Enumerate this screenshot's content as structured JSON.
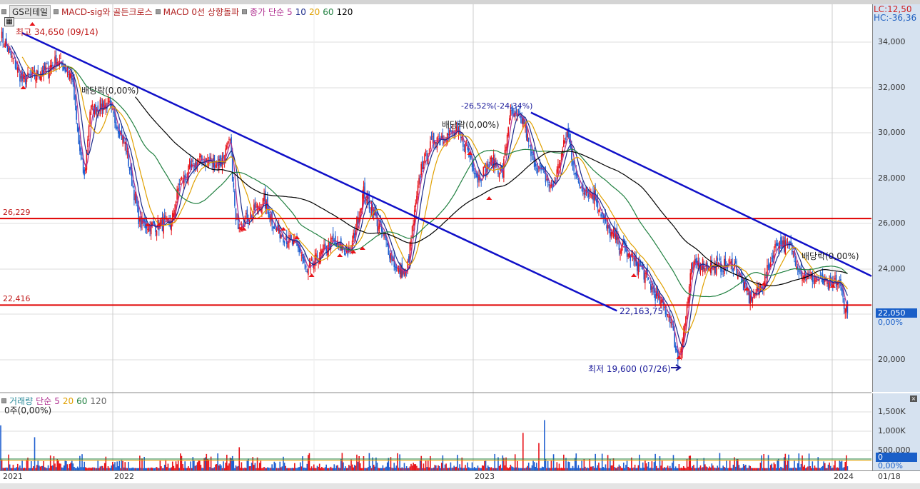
{
  "legend": {
    "symbol": "GS리테일",
    "items": [
      {
        "label": "MACD-sig와 골든크로스",
        "color": "#b22222"
      },
      {
        "label": "MACD 0선 상향돌파",
        "color": "#b22222"
      },
      {
        "label": "종가 단순",
        "color": "#b03090"
      }
    ],
    "ma": [
      {
        "label": "5",
        "color": "#b03090"
      },
      {
        "label": "10",
        "color": "#1a2a8a"
      },
      {
        "label": "20",
        "color": "#e0a000"
      },
      {
        "label": "60",
        "color": "#208040"
      },
      {
        "label": "120",
        "color": "#000000"
      }
    ]
  },
  "axis": {
    "lc": "LC:12,50",
    "hc": "HC:-36,36",
    "price_ticks": [
      "34,000",
      "32,000",
      "30,000",
      "28,000",
      "26,000",
      "24,000",
      "20,000"
    ],
    "current_price": "22,050",
    "current_pct": "0,00%",
    "volume_ticks": [
      "1,500K",
      "1,000K",
      "500,000"
    ],
    "volume_current": "0",
    "volume_pct": "0,00%",
    "date": "01/18"
  },
  "x_labels": [
    "2021",
    "2022",
    "2023",
    "2024"
  ],
  "annotations": {
    "high": "최고 34,650 (09/14)",
    "low": "최저 19,600 (07/26)",
    "div1": "배당락(0,00%)",
    "div2": "배당락(0,00%)",
    "div3": "배당락(0,00%)",
    "trend_pct": "-26,52%(-24,34%)",
    "trend_val": "22,163,75",
    "h1": "26,229",
    "h2": "22,416"
  },
  "volume_legend": {
    "title": "거래량",
    "simple": "단순",
    "ma": [
      {
        "label": "5",
        "color": "#b03090"
      },
      {
        "label": "20",
        "color": "#e0a000"
      },
      {
        "label": "60",
        "color": "#208040"
      },
      {
        "label": "120",
        "color": "#666666"
      }
    ],
    "value": "0주(0,00%)"
  },
  "colors": {
    "up": "#e8141a",
    "down": "#1f5fd0",
    "trend": "#1010c8",
    "hline": "#e00000"
  },
  "chart_data": {
    "type": "candlestick",
    "total_days": 750,
    "price_range": [
      19000,
      35000
    ],
    "hlines": [
      26229,
      22416
    ],
    "trendlines": [
      [
        [
          19,
          34400
        ],
        [
          545,
          22164
        ]
      ],
      [
        [
          469,
          30900
        ],
        [
          770,
          23700
        ]
      ]
    ],
    "waypoints": [
      [
        0,
        34300
      ],
      [
        13,
        33000
      ],
      [
        19,
        32300
      ],
      [
        38,
        32700
      ],
      [
        50,
        33200
      ],
      [
        63,
        32500
      ],
      [
        69,
        29500
      ],
      [
        74,
        28000
      ],
      [
        79,
        31000
      ],
      [
        95,
        31300
      ],
      [
        110,
        29500
      ],
      [
        123,
        26000
      ],
      [
        135,
        25900
      ],
      [
        151,
        26000
      ],
      [
        158,
        27800
      ],
      [
        176,
        28800
      ],
      [
        195,
        28700
      ],
      [
        203,
        29600
      ],
      [
        208,
        26000
      ],
      [
        217,
        26200
      ],
      [
        233,
        27000
      ],
      [
        243,
        25800
      ],
      [
        265,
        24800
      ],
      [
        271,
        23800
      ],
      [
        277,
        24300
      ],
      [
        293,
        25200
      ],
      [
        309,
        24700
      ],
      [
        321,
        27400
      ],
      [
        334,
        26000
      ],
      [
        350,
        24000
      ],
      [
        359,
        23800
      ],
      [
        364,
        25700
      ],
      [
        372,
        28500
      ],
      [
        384,
        29800
      ],
      [
        403,
        30000
      ],
      [
        413,
        29300
      ],
      [
        422,
        28000
      ],
      [
        435,
        28800
      ],
      [
        444,
        28200
      ],
      [
        450,
        30800
      ],
      [
        463,
        30500
      ],
      [
        469,
        29000
      ],
      [
        482,
        28000
      ],
      [
        488,
        27500
      ],
      [
        501,
        30000
      ],
      [
        510,
        27800
      ],
      [
        526,
        27200
      ],
      [
        536,
        25800
      ],
      [
        554,
        24700
      ],
      [
        567,
        24000
      ],
      [
        580,
        22800
      ],
      [
        592,
        21900
      ],
      [
        599,
        20000
      ],
      [
        605,
        21500
      ],
      [
        611,
        24000
      ],
      [
        617,
        24300
      ],
      [
        630,
        24100
      ],
      [
        649,
        24200
      ],
      [
        662,
        22700
      ],
      [
        674,
        23300
      ],
      [
        687,
        25200
      ],
      [
        699,
        24900
      ],
      [
        709,
        23800
      ],
      [
        725,
        23500
      ],
      [
        734,
        23200
      ],
      [
        741,
        23500
      ],
      [
        745,
        22700
      ],
      [
        749,
        22050
      ]
    ]
  }
}
